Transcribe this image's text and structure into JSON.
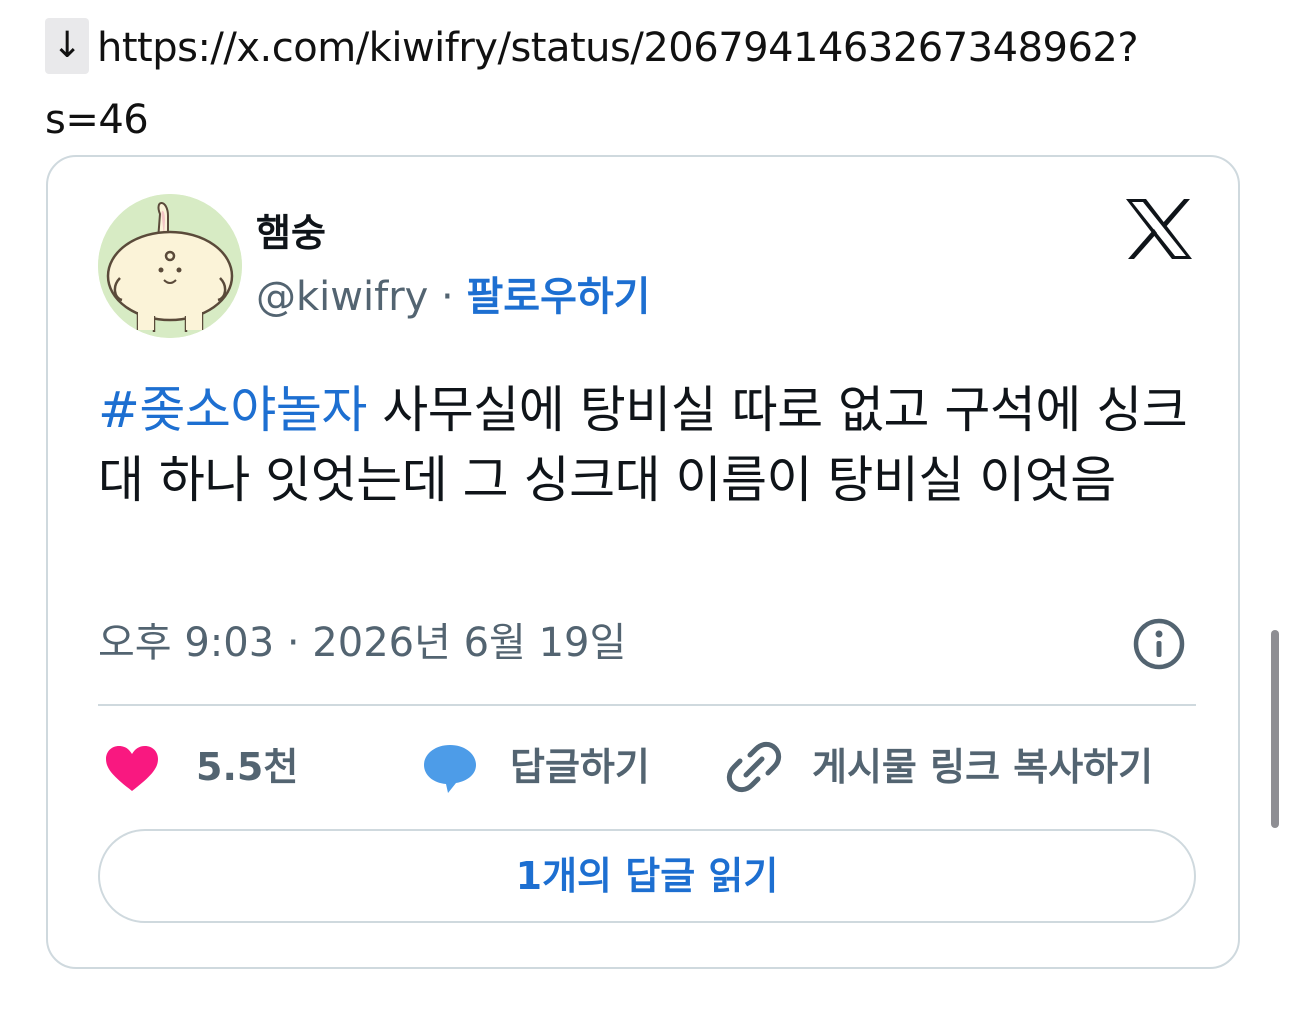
{
  "download_arrow": "↓",
  "source_url": "https://x.com/kiwifry/status/2067941463267348962?s=46",
  "tweet": {
    "author_name": "햄숭",
    "handle": "@kiwifry",
    "separator": "·",
    "follow_label": "팔로우하기",
    "hashtag": "#좆소야놀자",
    "body": " 사무실에 탕비실 따로 없고 구석에 싱크대 하나 잇엇는데 그 싱크대 이름이 탕비실 이엇음",
    "time": "오후 9:03",
    "date": "2026년 6월 19일",
    "likes": "5.5천",
    "reply_label": "답글하기",
    "copy_link_label": "게시물 링크 복사하기",
    "read_replies_label": "1개의 답글 읽기"
  },
  "colors": {
    "link_blue": "#1d6fd1",
    "heart_pink": "#f91880",
    "reply_blue": "#4d9ce8",
    "muted_gray": "#536471",
    "border_gray": "#cfd9de"
  },
  "icons": [
    "x-logo-icon",
    "info-icon",
    "heart-icon",
    "speech-bubble-icon",
    "link-icon"
  ]
}
